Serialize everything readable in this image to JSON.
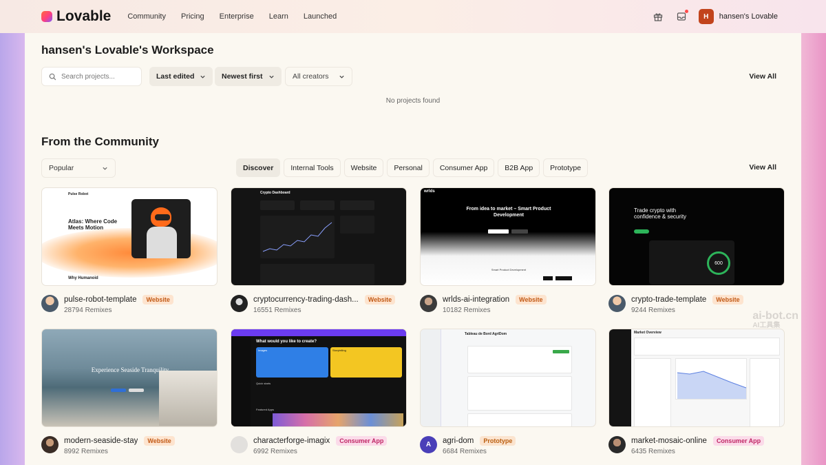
{
  "header": {
    "brand": "Lovable",
    "nav": [
      "Community",
      "Pricing",
      "Enterprise",
      "Learn",
      "Launched"
    ],
    "user_initial": "H",
    "user_name": "hansen's Lovable"
  },
  "workspace": {
    "title": "hansen's Lovable's Workspace",
    "search_placeholder": "Search projects...",
    "sort_label": "Last edited",
    "order_label": "Newest first",
    "creators_label": "All creators",
    "view_all": "View All",
    "empty_text": "No projects found"
  },
  "community": {
    "title": "From the Community",
    "filter_label": "Popular",
    "tabs": [
      "Discover",
      "Internal Tools",
      "Website",
      "Personal",
      "Consumer App",
      "B2B App",
      "Prototype"
    ],
    "view_all": "View All",
    "projects": [
      {
        "name": "pulse-robot-template",
        "badge": "Website",
        "remixes": "28794 Remixes"
      },
      {
        "name": "cryptocurrency-trading-dash...",
        "badge": "Website",
        "remixes": "16551 Remixes"
      },
      {
        "name": "wrlds-ai-integration",
        "badge": "Website",
        "remixes": "10182 Remixes"
      },
      {
        "name": "crypto-trade-template",
        "badge": "Website",
        "remixes": "9244 Remixes"
      },
      {
        "name": "modern-seaside-stay",
        "badge": "Website",
        "remixes": "8992 Remixes"
      },
      {
        "name": "characterforge-imagix",
        "badge": "Consumer App",
        "remixes": "6992 Remixes"
      },
      {
        "name": "agri-dom",
        "badge": "Prototype",
        "remixes": "6684 Remixes",
        "avatar_letter": "A"
      },
      {
        "name": "market-mosaic-online",
        "badge": "Consumer App",
        "remixes": "6435 Remixes"
      }
    ]
  },
  "thumbs": {
    "pulse": {
      "brand": "Pulse Robot",
      "headline": "Atlas: Where Code Meets Motion",
      "sub": "Why Humanoid"
    },
    "crypto_dash": {
      "title": "Crypto Dashboard"
    },
    "wrlds": {
      "logo": "wrlds",
      "headline": "From idea to market – Smart Product Development",
      "sub": "Smart Product Development"
    },
    "crypto_trade": {
      "headline": "Trade crypto with confidence & security",
      "value": "600"
    },
    "seaside": {
      "headline": "Experience Seaside Tranquility"
    },
    "charforge": {
      "question": "What would you like to create?",
      "opt1": "Images",
      "opt2": "Storytelling",
      "s1": "Quick starts",
      "s2": "Featured Apps"
    },
    "agri": {
      "title": "Tableau de Bord AgriDom"
    },
    "market": {
      "title": "Market Overview"
    }
  },
  "watermark": {
    "line1": "ai-bot.cn",
    "line2": "AI工具集"
  }
}
